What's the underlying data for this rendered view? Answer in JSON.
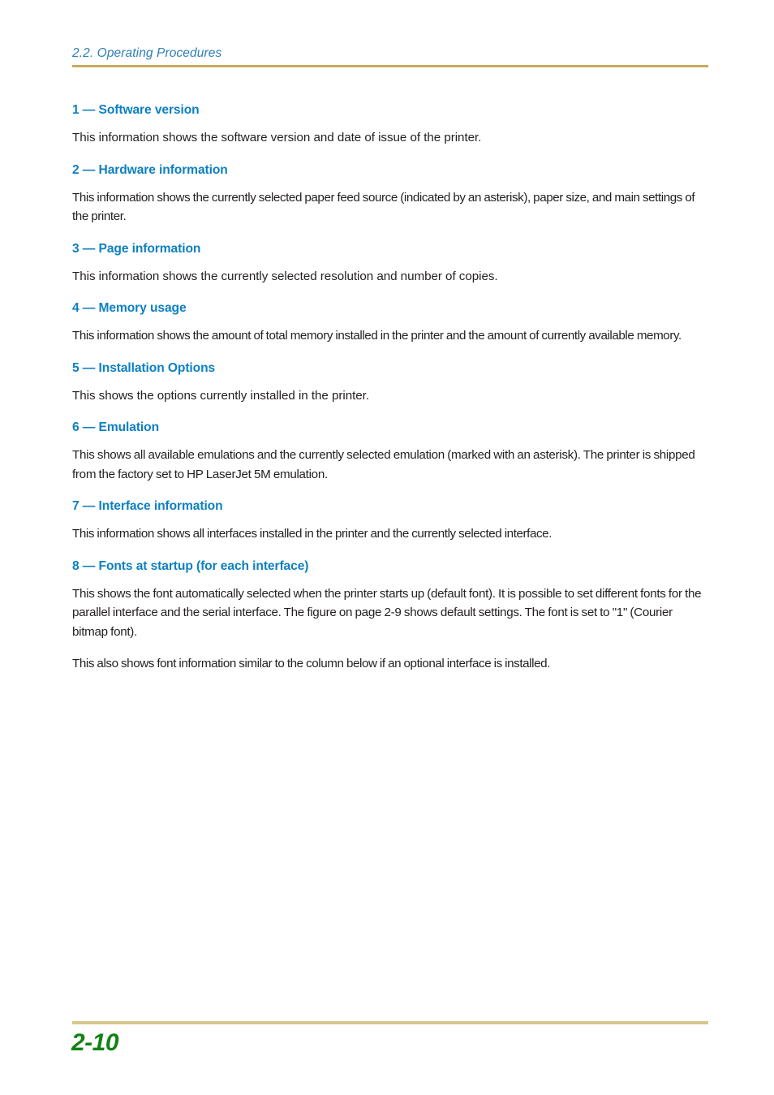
{
  "page": {
    "running_header": "2.2. Operating Procedures",
    "folio": "2-10",
    "colors": {
      "heading_blue": "#0d80c2",
      "header_blue": "#2e7eb8",
      "header_rule_gold": "#c8aa5f",
      "footer_rule_gold": "#d7c78b",
      "folio_green": "#128312",
      "body_text": "#231f20",
      "background": "#ffffff"
    }
  },
  "sections": [
    {
      "heading": "1 — Software version",
      "paragraphs": [
        "This information shows the software version and date of issue of the printer."
      ]
    },
    {
      "heading": "2 — Hardware information",
      "paragraphs": [
        "This information shows the currently selected paper feed source (indicated by an asterisk), paper size, and main settings of the printer."
      ]
    },
    {
      "heading": "3 — Page information",
      "paragraphs": [
        "This information shows the currently selected resolution and number of copies."
      ]
    },
    {
      "heading": "4 — Memory usage",
      "paragraphs": [
        "This information shows the amount of total memory installed in the printer and the amount of currently available memory."
      ]
    },
    {
      "heading": "5 — Installation Options",
      "paragraphs": [
        "This shows the options currently installed in the printer."
      ]
    },
    {
      "heading": "6 — Emulation",
      "paragraphs": [
        "This shows all available emulations and the currently selected emulation (marked with an asterisk). The printer is shipped from the factory set to HP LaserJet 5M emulation."
      ]
    },
    {
      "heading": "7 — Interface information",
      "paragraphs": [
        "This information shows all interfaces installed in the printer and the currently selected interface."
      ]
    },
    {
      "heading": "8 — Fonts at startup (for each interface)",
      "paragraphs": [
        "This shows the font automatically selected when the printer starts up (default font). It is possible to set different fonts for the parallel interface and the serial interface. The figure on page 2-9 shows default settings. The font is set to \"1\" (Courier bitmap font).",
        "This also shows font information similar to the column below if an optional interface is installed."
      ]
    }
  ]
}
